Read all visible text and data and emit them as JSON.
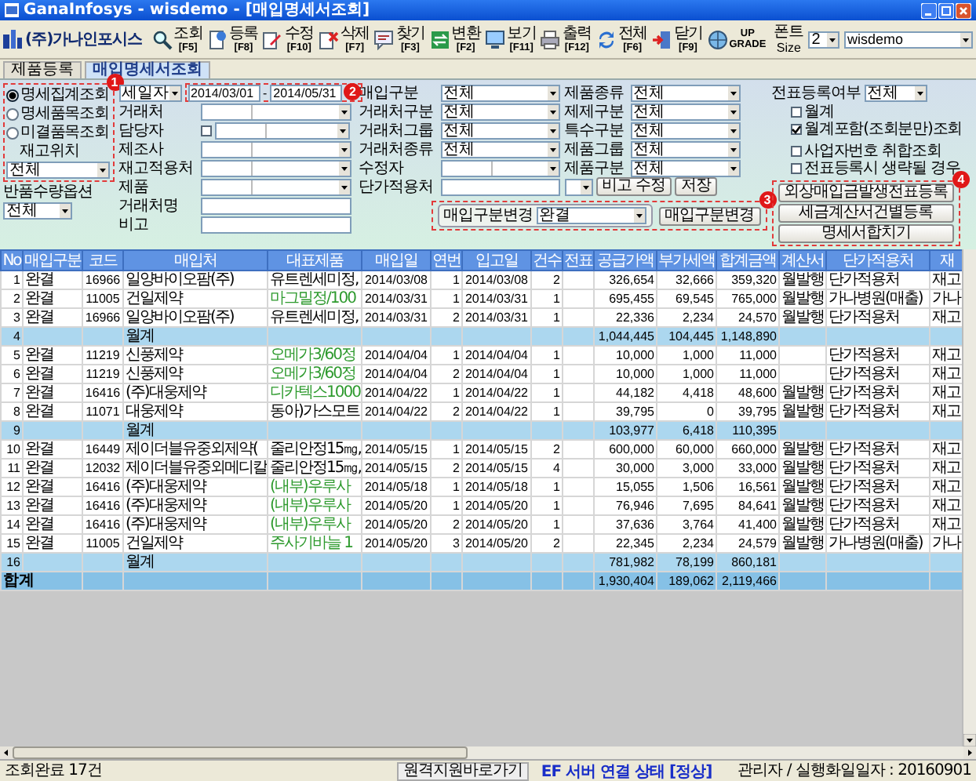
{
  "window": {
    "title": "GanaInfosys - wisdemo - [매입명세서조회]"
  },
  "toolbar": {
    "company": "(주)가나인포시스",
    "buttons": [
      {
        "label": "조회",
        "key": "[F5]",
        "kind": "search"
      },
      {
        "label": "등록",
        "key": "[F8]",
        "kind": "register"
      },
      {
        "label": "수정",
        "key": "[F10]",
        "kind": "edit"
      },
      {
        "label": "삭제",
        "key": "[F7]",
        "kind": "delete"
      },
      {
        "label": "찾기",
        "key": "[F3]",
        "kind": "find"
      },
      {
        "label": "변환",
        "key": "[F2]",
        "kind": "convert"
      },
      {
        "label": "보기",
        "key": "[F11]",
        "kind": "view"
      },
      {
        "label": "출력",
        "key": "[F12]",
        "kind": "print"
      },
      {
        "label": "전체",
        "key": "[F6]",
        "kind": "all"
      },
      {
        "label": "닫기",
        "key": "[F9]",
        "kind": "close"
      },
      {
        "label": "UP",
        "key": "GRADE",
        "kind": "upgrade"
      }
    ],
    "font_size": {
      "label": "폰트",
      "sublabel": "Size",
      "value": "2"
    },
    "user": {
      "value": "wisdemo"
    }
  },
  "tabs": [
    {
      "label": "제품등록",
      "selected": false
    },
    {
      "label": "매입명세서조회",
      "selected": true
    }
  ],
  "filters": {
    "search_modes": [
      {
        "label": "명세집계조회",
        "selected": true
      },
      {
        "label": "명세품목조회",
        "selected": false
      },
      {
        "label": "미결품목조회",
        "selected": false
      }
    ],
    "stock_location": {
      "label": "재고위치",
      "value": "전체"
    },
    "return_option": {
      "label": "반품수량옵션",
      "value": "전체"
    },
    "date_type": "세일자",
    "date_from": "2014/03/01",
    "date_sep": "-",
    "date_to": "2014/05/31",
    "left_fields": [
      {
        "label": "거래처",
        "kind": "combo"
      },
      {
        "label": "담당자",
        "kind": "check-combo",
        "checked": false
      },
      {
        "label": "제조사",
        "kind": "combo"
      },
      {
        "label": "재고적용처",
        "kind": "combo"
      },
      {
        "label": "제품",
        "kind": "combo"
      },
      {
        "label": "거래처명",
        "kind": "input"
      },
      {
        "label": "비고",
        "kind": "input"
      }
    ],
    "mid_fields": [
      {
        "label": "매입구분",
        "kind": "select",
        "value": "전체"
      },
      {
        "label": "거래처구분",
        "kind": "select",
        "value": "전체"
      },
      {
        "label": "거래처그룹",
        "kind": "select",
        "value": "전체"
      },
      {
        "label": "거래처종류",
        "kind": "select",
        "value": "전체"
      },
      {
        "label": "수정자",
        "kind": "combo"
      },
      {
        "label": "단가적용처",
        "kind": "input"
      }
    ],
    "right_fields": [
      {
        "label": "제품종류",
        "value": "전체"
      },
      {
        "label": "제제구분",
        "value": "전체"
      },
      {
        "label": "특수구분",
        "value": "전체"
      },
      {
        "label": "제품그룹",
        "value": "전체"
      },
      {
        "label": "제품구분",
        "value": "전체"
      }
    ],
    "memo_button": "비고 수정",
    "save_button": "저장",
    "purchase_type_change": {
      "label": "매입구분변경",
      "value": "완결",
      "button": "매입구분변경"
    },
    "slip_registered": {
      "label": "전표등록여부",
      "value": "전체"
    },
    "options": [
      {
        "label": "월계",
        "checked": false
      },
      {
        "label": "월계포함(조회분만)조회",
        "checked": true
      },
      {
        "label": "사업자번호 취합조회",
        "checked": false
      },
      {
        "label": "전표등록시 생략될 경우",
        "checked": false
      }
    ],
    "action_buttons": [
      "외상매입금발생전표등록",
      "세금계산서건별등록",
      "명세서합치기"
    ]
  },
  "annotations": [
    {
      "number": "1"
    },
    {
      "number": "2"
    },
    {
      "number": "3"
    },
    {
      "number": "4"
    }
  ],
  "table": {
    "columns": [
      "No",
      "매입구분",
      "코드",
      "매입처",
      "대표제품",
      "매입일",
      "연번",
      "입고일",
      "건수",
      "전표",
      "공급가액",
      "부가세액",
      "합계금액",
      "계산서",
      "단가적용처",
      "재"
    ],
    "rows": [
      {
        "kind": "item",
        "no": "1",
        "type": "완결",
        "code": "16966",
        "vendor": "일양바이오팜(주)",
        "product": "유트렌세미정,",
        "color": "#000000",
        "purchase_date": "2014/03/08",
        "seq": "1",
        "receipt_date": "2014/03/08",
        "count": "2",
        "supply": "326,654",
        "vat": "32,666",
        "total": "359,320",
        "invoice": "월발행",
        "price_target": "단가적용처",
        "col_16": "재고"
      },
      {
        "kind": "item",
        "no": "2",
        "type": "완결",
        "code": "11005",
        "vendor": "건일제약",
        "product": "마그밀정/100",
        "color": "#2e9a2e",
        "purchase_date": "2014/03/31",
        "seq": "1",
        "receipt_date": "2014/03/31",
        "count": "1",
        "supply": "695,455",
        "vat": "69,545",
        "total": "765,000",
        "invoice": "월발행",
        "price_target": "가나병원(매출)",
        "col_16": "가나"
      },
      {
        "kind": "item",
        "no": "3",
        "type": "완결",
        "code": "16966",
        "vendor": "일양바이오팜(주)",
        "product": "유트렌세미정,",
        "color": "#000000",
        "purchase_date": "2014/03/31",
        "seq": "2",
        "receipt_date": "2014/03/31",
        "count": "1",
        "supply": "22,336",
        "vat": "2,234",
        "total": "24,570",
        "invoice": "월발행",
        "price_target": "단가적용처",
        "col_16": "재고"
      },
      {
        "kind": "subtotal",
        "no": "4",
        "vendor": "월계",
        "supply": "1,044,445",
        "vat": "104,445",
        "total": "1,148,890"
      },
      {
        "kind": "item",
        "no": "5",
        "type": "완결",
        "code": "11219",
        "vendor": "신풍제약",
        "product": "오메가3/60정",
        "color": "#2e9a2e",
        "purchase_date": "2014/04/04",
        "seq": "1",
        "receipt_date": "2014/04/04",
        "count": "1",
        "supply": "10,000",
        "vat": "1,000",
        "total": "11,000",
        "price_target": "단가적용처",
        "col_16": "재고"
      },
      {
        "kind": "item",
        "no": "6",
        "type": "완결",
        "code": "11219",
        "vendor": "신풍제약",
        "product": "오메가3/60정",
        "color": "#2e9a2e",
        "purchase_date": "2014/04/04",
        "seq": "2",
        "receipt_date": "2014/04/04",
        "count": "1",
        "supply": "10,000",
        "vat": "1,000",
        "total": "11,000",
        "price_target": "단가적용처",
        "col_16": "재고"
      },
      {
        "kind": "item",
        "no": "7",
        "type": "완결",
        "code": "16416",
        "vendor": "(주)대웅제약",
        "product": "디카텍스1000",
        "color": "#2e9a2e",
        "purchase_date": "2014/04/22",
        "seq": "1",
        "receipt_date": "2014/04/22",
        "count": "1",
        "supply": "44,182",
        "vat": "4,418",
        "total": "48,600",
        "invoice": "월발행",
        "price_target": "단가적용처",
        "col_16": "재고"
      },
      {
        "kind": "item",
        "no": "8",
        "type": "완결",
        "code": "11071",
        "vendor": "대웅제약",
        "product": "동아)가스모트",
        "color": "#000000",
        "purchase_date": "2014/04/22",
        "seq": "2",
        "receipt_date": "2014/04/22",
        "count": "1",
        "supply": "39,795",
        "vat": "0",
        "total": "39,795",
        "invoice": "월발행",
        "price_target": "단가적용처",
        "col_16": "재고"
      },
      {
        "kind": "subtotal",
        "no": "9",
        "vendor": "월계",
        "supply": "103,977",
        "vat": "6,418",
        "total": "110,395"
      },
      {
        "kind": "item",
        "no": "10",
        "type": "완결",
        "code": "16449",
        "vendor": "제이더블유중외제약(",
        "product": "줄리안정15㎎,",
        "color": "#000000",
        "purchase_date": "2014/05/15",
        "seq": "1",
        "receipt_date": "2014/05/15",
        "count": "2",
        "supply": "600,000",
        "vat": "60,000",
        "total": "660,000",
        "invoice": "월발행",
        "price_target": "단가적용처",
        "col_16": "재고"
      },
      {
        "kind": "item",
        "no": "11",
        "type": "완결",
        "code": "12032",
        "vendor": "제이더블유중외메디칼",
        "product": "줄리안정15㎎,",
        "color": "#000000",
        "purchase_date": "2014/05/15",
        "seq": "2",
        "receipt_date": "2014/05/15",
        "count": "4",
        "supply": "30,000",
        "vat": "3,000",
        "total": "33,000",
        "invoice": "월발행",
        "price_target": "단가적용처",
        "col_16": "재고"
      },
      {
        "kind": "item",
        "no": "12",
        "type": "완결",
        "code": "16416",
        "vendor": "(주)대웅제약",
        "product": "(내부)우루사",
        "color": "#2e9a2e",
        "purchase_date": "2014/05/18",
        "seq": "1",
        "receipt_date": "2014/05/18",
        "count": "1",
        "supply": "15,055",
        "vat": "1,506",
        "total": "16,561",
        "invoice": "월발행",
        "price_target": "단가적용처",
        "col_16": "재고"
      },
      {
        "kind": "item",
        "no": "13",
        "type": "완결",
        "code": "16416",
        "vendor": "(주)대웅제약",
        "product": "(내부)우루사",
        "color": "#2e9a2e",
        "purchase_date": "2014/05/20",
        "seq": "1",
        "receipt_date": "2014/05/20",
        "count": "1",
        "supply": "76,946",
        "vat": "7,695",
        "total": "84,641",
        "invoice": "월발행",
        "price_target": "단가적용처",
        "col_16": "재고"
      },
      {
        "kind": "item",
        "no": "14",
        "type": "완결",
        "code": "16416",
        "vendor": "(주)대웅제약",
        "product": "(내부)우루사",
        "color": "#2e9a2e",
        "purchase_date": "2014/05/20",
        "seq": "2",
        "receipt_date": "2014/05/20",
        "count": "1",
        "supply": "37,636",
        "vat": "3,764",
        "total": "41,400",
        "invoice": "월발행",
        "price_target": "단가적용처",
        "col_16": "재고"
      },
      {
        "kind": "item",
        "no": "15",
        "type": "완결",
        "code": "11005",
        "vendor": "건일제약",
        "product": "주사기바늘 1",
        "color": "#2e9a2e",
        "purchase_date": "2014/05/20",
        "seq": "3",
        "receipt_date": "2014/05/20",
        "count": "2",
        "supply": "22,345",
        "vat": "2,234",
        "total": "24,579",
        "invoice": "월발행",
        "price_target": "가나병원(매출)",
        "col_16": "가나"
      },
      {
        "kind": "subtotal",
        "no": "16",
        "vendor": "월계",
        "supply": "781,982",
        "vat": "78,199",
        "total": "860,181"
      },
      {
        "kind": "total",
        "label": "합계",
        "supply": "1,930,404",
        "vat": "189,062",
        "total": "2,119,466"
      }
    ]
  },
  "status_bar": {
    "message": "조회완료 17건",
    "remote_button": "원격지원바로가기",
    "connection": "EF 서버 연결 상태 [정상]",
    "info": "관리자 / 실행화일일자 : 20160901"
  }
}
